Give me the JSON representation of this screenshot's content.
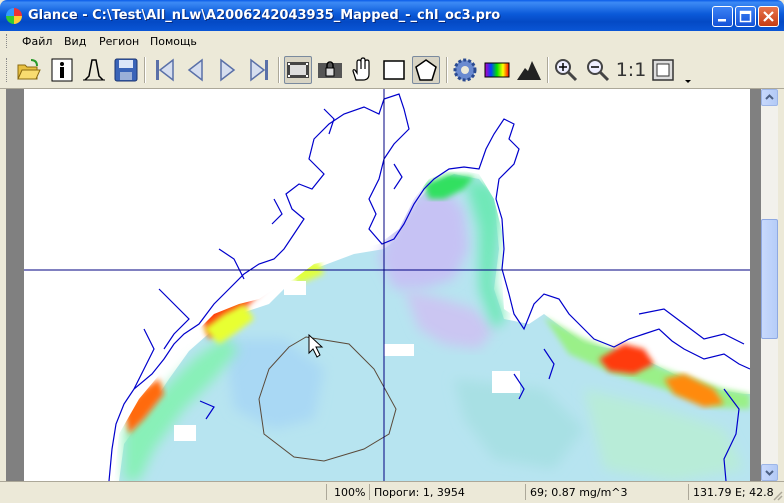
{
  "window": {
    "title": "Glance - C:\\Test\\All_nLw\\A2006242043935_Mapped_-_chl_oc3.pro"
  },
  "menu": {
    "items": [
      "Файл",
      "Вид",
      "Регион",
      "Помощь"
    ]
  },
  "toolbar": {
    "zoom_1to1_label": "1:1"
  },
  "status": {
    "zoom": "100%",
    "thresholds": "Пороги: 1, 3954",
    "value": "69; 0.87 mg/m^3",
    "coords": "131.79 E; 42.8"
  },
  "colors": {
    "titlebar": "#0a56d6",
    "coastline": "#0000cc",
    "crosshair": "#000080",
    "polygon": "#5a4a3a"
  },
  "icons": [
    "open-folder-icon",
    "info-icon",
    "histogram-icon",
    "save-icon",
    "first-frame-icon",
    "prev-frame-icon",
    "next-frame-icon",
    "last-frame-icon",
    "filmstrip-icon",
    "lock-filmstrip-icon",
    "hand-icon",
    "rectangle-icon",
    "polygon-icon",
    "gear-icon",
    "palette-icon",
    "mountain-icon",
    "zoom-in-icon",
    "zoom-out-icon",
    "fit-window-icon"
  ]
}
